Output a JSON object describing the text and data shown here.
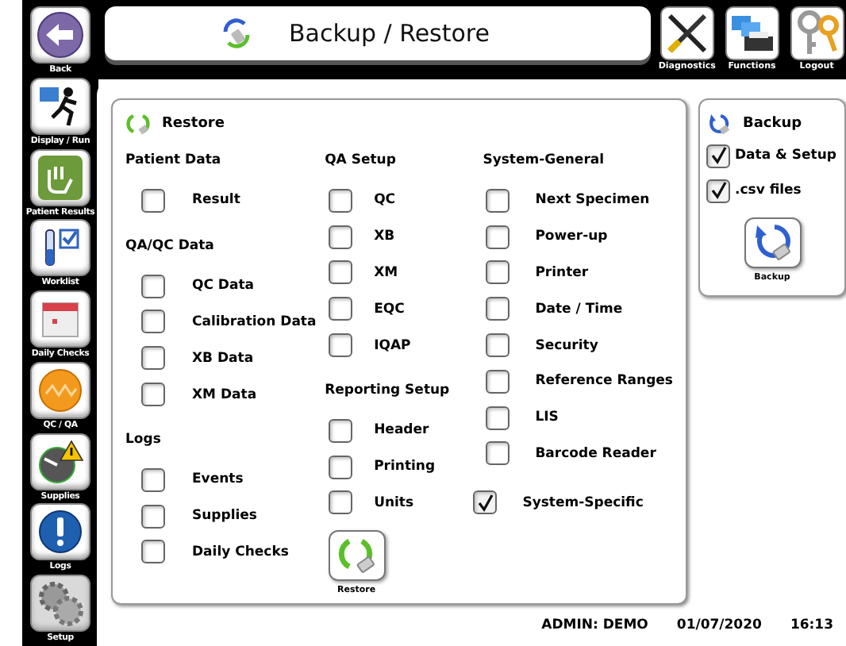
{
  "nav": {
    "back": "Back",
    "items": [
      {
        "label": "Display / Run",
        "selected": false
      },
      {
        "label": "Patient Results",
        "selected": false
      },
      {
        "label": "Worklist",
        "selected": false
      },
      {
        "label": "Daily Checks",
        "selected": false
      },
      {
        "label": "QC / QA",
        "selected": false
      },
      {
        "label": "Supplies",
        "selected": false
      },
      {
        "label": "Logs",
        "selected": false
      },
      {
        "label": "Setup",
        "selected": true
      }
    ]
  },
  "header": {
    "title": "Backup / Restore",
    "tools": [
      {
        "label": "Diagnostics"
      },
      {
        "label": "Functions"
      },
      {
        "label": "Logout"
      }
    ]
  },
  "restore": {
    "title": "Restore",
    "button": "Restore",
    "columns": [
      {
        "groups": [
          {
            "title": "Patient Data",
            "items": [
              {
                "label": "Result",
                "checked": false
              }
            ]
          },
          {
            "title": "QA/QC Data",
            "items": [
              {
                "label": "QC Data",
                "checked": false
              },
              {
                "label": "Calibration Data",
                "checked": false
              },
              {
                "label": "XB Data",
                "checked": false
              },
              {
                "label": "XM Data",
                "checked": false
              }
            ]
          },
          {
            "title": "Logs",
            "items": [
              {
                "label": "Events",
                "checked": false
              },
              {
                "label": "Supplies",
                "checked": false
              },
              {
                "label": "Daily Checks",
                "checked": false
              }
            ]
          }
        ]
      },
      {
        "groups": [
          {
            "title": "QA Setup",
            "items": [
              {
                "label": "QC",
                "checked": false
              },
              {
                "label": "XB",
                "checked": false
              },
              {
                "label": "XM",
                "checked": false
              },
              {
                "label": "EQC",
                "checked": false
              },
              {
                "label": "IQAP",
                "checked": false
              }
            ]
          },
          {
            "title": "Reporting Setup",
            "items": [
              {
                "label": "Header",
                "checked": false
              },
              {
                "label": "Printing",
                "checked": false
              },
              {
                "label": "Units",
                "checked": false
              }
            ]
          }
        ]
      },
      {
        "groups": [
          {
            "title": "System-General",
            "items": [
              {
                "label": "Next Specimen",
                "checked": false
              },
              {
                "label": "Power-up",
                "checked": false
              },
              {
                "label": "Printer",
                "checked": false
              },
              {
                "label": "Date / Time",
                "checked": false
              },
              {
                "label": "Security",
                "checked": false
              },
              {
                "label": "Reference Ranges",
                "checked": false
              },
              {
                "label": "LIS",
                "checked": false
              },
              {
                "label": "Barcode Reader",
                "checked": false
              }
            ]
          },
          {
            "items": [
              {
                "label": "System-Specific",
                "checked": true
              }
            ]
          }
        ]
      }
    ]
  },
  "backup": {
    "title": "Backup",
    "button": "Backup",
    "options": [
      {
        "label": "Data & Setup",
        "checked": true
      },
      {
        "label": ".csv files",
        "checked": true
      }
    ]
  },
  "status": {
    "user": "ADMIN: DEMO",
    "date": "01/07/2020",
    "time": "16:13"
  }
}
